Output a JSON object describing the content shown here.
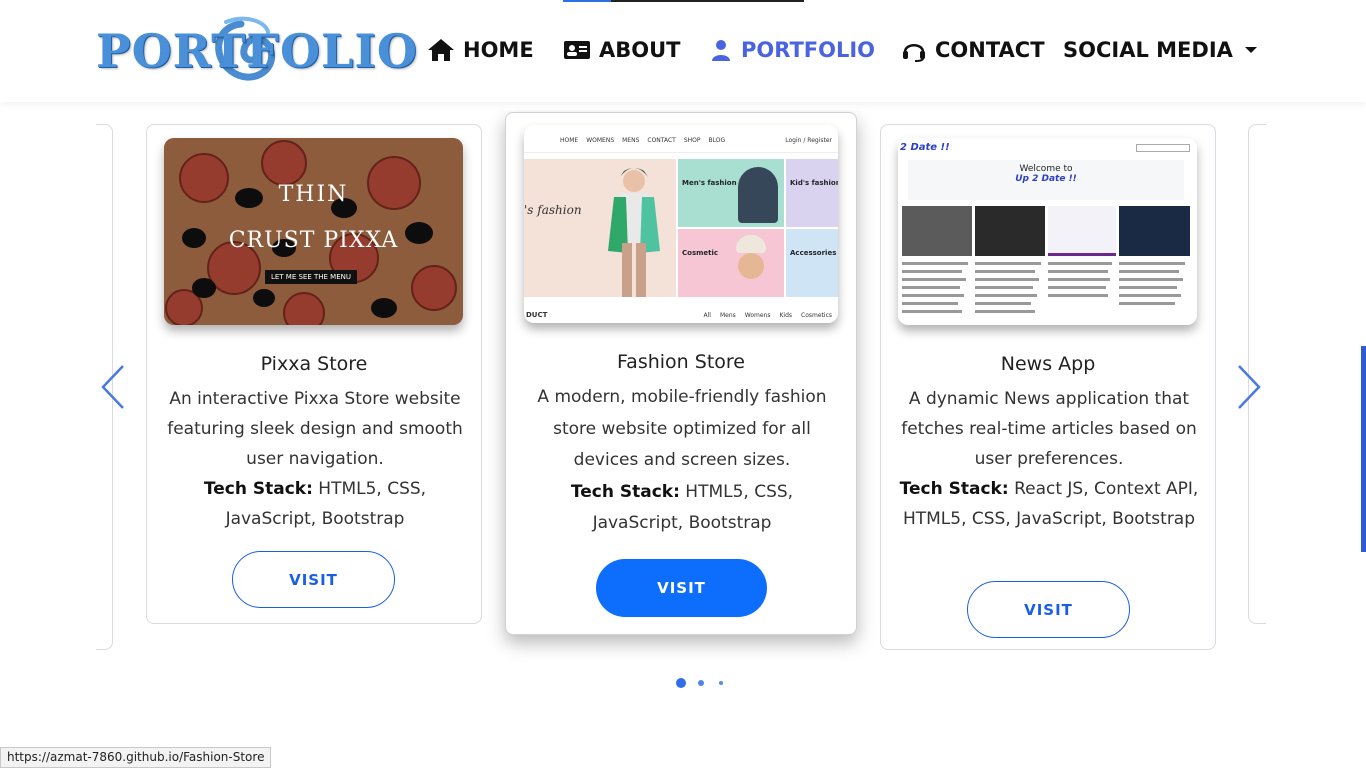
{
  "nav": {
    "logo_text": "PORTFOLIO",
    "items": [
      {
        "label": "HOME",
        "icon": "home-icon"
      },
      {
        "label": "ABOUT",
        "icon": "id-card-icon"
      },
      {
        "label": "PORTFOLIO",
        "icon": "user-icon",
        "active": true
      },
      {
        "label": "CONTACT",
        "icon": "headset-icon"
      },
      {
        "label": "SOCIAL MEDIA",
        "icon": "chevron-down-icon"
      }
    ]
  },
  "projects": [
    {
      "title": "Pixxa Store",
      "description": "An interactive Pixxa Store website featuring sleek design and smooth user navigation.",
      "tech_label": "Tech Stack:",
      "tech": "HTML5, CSS, JavaScript, Bootstrap",
      "button": "VISIT",
      "preview": {
        "line1": "THIN",
        "line2": "CRUST PIXXA",
        "tag": "LET ME SEE THE MENU"
      }
    },
    {
      "title": "Fashion Store",
      "description": "A modern, mobile-friendly fashion store website optimized for all devices and screen sizes.",
      "tech_label": "Tech Stack:",
      "tech": "HTML5, CSS, JavaScript, Bootstrap",
      "button": "VISIT",
      "preview": {
        "nav": [
          "HOME",
          "WOMENS",
          "MENS",
          "CONTACT",
          "SHOP",
          "BLOG"
        ],
        "login": "Login",
        "register": "Register",
        "hero": "'s fashion",
        "tiles": [
          "Men's fashion",
          "Kid's fashion",
          "Cosmetic",
          "Accessories"
        ],
        "footer_left": "DUCT",
        "footer_tabs": [
          "All",
          "Mens",
          "Womens",
          "Kids",
          "Cosmetics"
        ]
      }
    },
    {
      "title": "News App",
      "description": "A dynamic News application that fetches real-time articles based on user preferences.",
      "tech_label": "Tech Stack:",
      "tech": "React JS, Context API, HTML5, CSS, JavaScript, Bootstrap",
      "button": "VISIT",
      "preview": {
        "brand": "2 Date !!",
        "welcome": "Welcome to",
        "welcome_brand": "Up 2 Date !!"
      }
    }
  ],
  "carousel": {
    "active_dot": 0,
    "dot_count": 3
  },
  "status_url": "https://azmat-7860.github.io/Fashion-Store",
  "colors": {
    "accent": "#0d6efd",
    "nav_active": "#4a63e0",
    "outline": "#1a5ee8"
  }
}
